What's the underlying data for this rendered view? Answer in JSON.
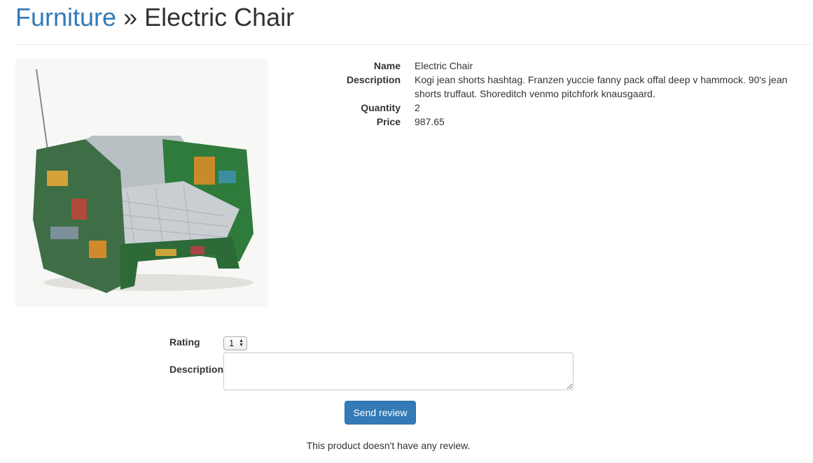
{
  "breadcrumb": {
    "category": "Furniture",
    "separator": "»",
    "current": "Electric Chair"
  },
  "product": {
    "image_alt": "Electric Chair",
    "fields": [
      {
        "term": "Name",
        "value": "Electric Chair"
      },
      {
        "term": "Description",
        "value": "Kogi jean shorts hashtag. Franzen yuccie fanny pack offal deep v hammock. 90's jean shorts truffaut. Shoreditch venmo pitchfork knausgaard."
      },
      {
        "term": "Quantity",
        "value": "2"
      },
      {
        "term": "Price",
        "value": "987.65"
      }
    ]
  },
  "review_form": {
    "rating_label": "Rating",
    "rating_value": "1",
    "description_label": "Description",
    "description_value": "",
    "submit_label": "Send review"
  },
  "reviews": {
    "empty_message": "This product doesn't have any review."
  },
  "colors": {
    "link": "#337ab7",
    "primary_button": "#337ab7",
    "text": "#333333"
  }
}
